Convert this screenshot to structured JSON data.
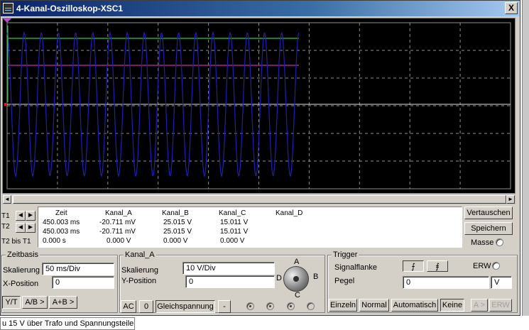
{
  "window": {
    "title": "4-Kanal-Oszilloskop-XSC1",
    "close_label": "X"
  },
  "taskbar": {
    "item_label": "u 15 V über Trafo und Spannungsteiler"
  },
  "readout": {
    "row_labels": [
      "T1",
      "T2",
      "T2 bis T1"
    ],
    "headers": [
      "Zeit",
      "Kanal_A",
      "Kanal_B",
      "Kanal_C",
      "Kanal_D"
    ],
    "rows": [
      [
        "450.003 ms",
        "-20.711 mV",
        "25.015 V",
        "15.011 V",
        ""
      ],
      [
        "450.003 ms",
        "-20.711 mV",
        "25.015 V",
        "15.011 V",
        ""
      ],
      [
        "0.000 s",
        "0.000 V",
        "0.000 V",
        "0.000 V",
        ""
      ]
    ]
  },
  "right_buttons": {
    "swap": "Vertauschen",
    "save": "Speichern",
    "ground": "Masse"
  },
  "timebase": {
    "group_label": "Zeitbasis",
    "scale_label": "Skalierung",
    "scale_value": "50 ms/Div",
    "xpos_label": "X-Position",
    "xpos_value": "0",
    "mode_buttons": [
      "Y/T",
      "A/B >",
      "A+B >"
    ]
  },
  "channel": {
    "group_label": "Kanal_A",
    "scale_label": "Skalierung",
    "scale_value": "10  V/Div",
    "ypos_label": "Y-Position",
    "ypos_value": "0",
    "coupling_buttons": [
      "AC",
      "0",
      "Gleichspannung",
      "-"
    ],
    "knob_labels": {
      "a": "A",
      "b": "B",
      "c": "C",
      "d": "D"
    }
  },
  "trigger": {
    "group_label": "Trigger",
    "edge_label": "Signalflanke",
    "level_label": "Pegel",
    "level_value": "0",
    "level_unit": "V",
    "ext_label": "ERW",
    "mode_buttons": [
      "Einzeln",
      "Normal",
      "Automatisch",
      "Keine"
    ],
    "source_buttons": [
      "A >",
      "ERW"
    ]
  },
  "icons": {
    "arrow_left": "◄",
    "arrow_right": "►",
    "scroll_left": "◄",
    "scroll_right": "►",
    "edge_rising": "⨍",
    "edge_falling": "⨎"
  },
  "colors": {
    "trace_a": "#1f1fb4",
    "trace_green": "#2ec84a",
    "trace_magenta": "#c02cb0",
    "trace_white": "#e0e0e0",
    "trigger_marker": "#b050c8"
  }
}
